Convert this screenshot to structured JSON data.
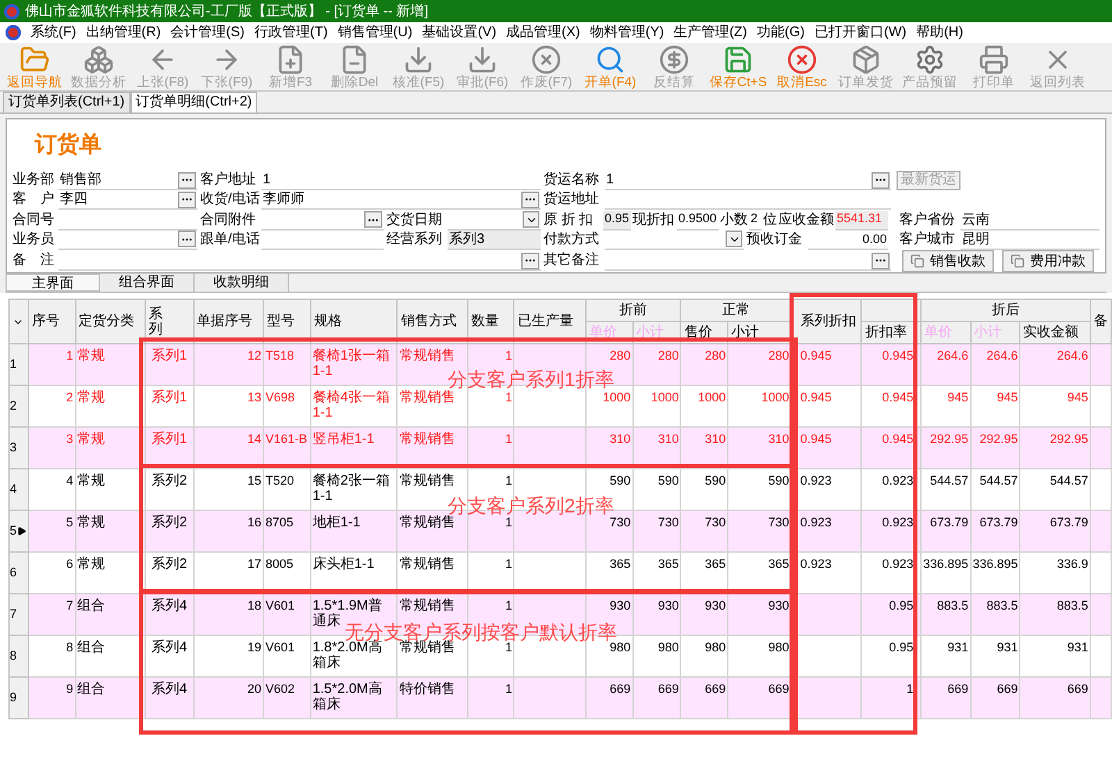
{
  "window": {
    "title": "佛山市金狐软件科技有限公司-工厂版【正式版】 - [订货单 -- 新增]"
  },
  "menu": [
    "系统(F)",
    "出纳管理(R)",
    "会计管理(S)",
    "行政管理(T)",
    "销售管理(U)",
    "基础设置(V)",
    "成品管理(X)",
    "物料管理(Y)",
    "生产管理(Z)",
    "功能(G)",
    "已打开窗口(W)",
    "帮助(H)"
  ],
  "toolbar": [
    {
      "label": "返回导航",
      "disabled": false
    },
    {
      "label": "数据分析",
      "disabled": true
    },
    {
      "label": "上张(F8)",
      "disabled": true
    },
    {
      "label": "下张(F9)",
      "disabled": true
    },
    {
      "label": "新增F3",
      "disabled": true
    },
    {
      "label": "删除Del",
      "disabled": true
    },
    {
      "label": "核准(F5)",
      "disabled": true
    },
    {
      "label": "审批(F6)",
      "disabled": true
    },
    {
      "label": "作废(F7)",
      "disabled": true
    },
    {
      "label": "开单(F4)",
      "disabled": false
    },
    {
      "label": "反结算",
      "disabled": true
    },
    {
      "label": "保存Ct+S",
      "disabled": false
    },
    {
      "label": "取消Esc",
      "disabled": false
    },
    {
      "label": "订单发货",
      "disabled": true
    },
    {
      "label": "产品预留",
      "disabled": true
    },
    {
      "label": "打印单",
      "disabled": true
    },
    {
      "label": "返回列表",
      "disabled": true
    }
  ],
  "tabs": [
    {
      "label": "订货单列表(Ctrl+1)",
      "selected": false
    },
    {
      "label": "订货单明细(Ctrl+2)",
      "selected": true
    }
  ],
  "form": {
    "title": "订货单",
    "department": {
      "label": "业务部",
      "value": "销售部"
    },
    "address": {
      "label": "客户地址",
      "value": "1"
    },
    "carrier_name": {
      "label": "货运名称",
      "value": "1"
    },
    "latest_carrier": {
      "label": "最新货运",
      "disabled": true
    },
    "customer": {
      "label": "客　户",
      "value": "李四"
    },
    "receiver": {
      "label": "收货/电话",
      "value": "李师师"
    },
    "carrier_address": {
      "label": "货运地址"
    },
    "contract_no": {
      "label": "合同号"
    },
    "contract_attachment": {
      "label": "合同附件"
    },
    "delivery_date": {
      "label": "交货日期"
    },
    "original_discount": {
      "label": "原 折 扣",
      "value": "0.95"
    },
    "current_discount": {
      "label": "现折扣",
      "value": "0.9500"
    },
    "decimals": {
      "label": "小数",
      "value": "2",
      "unit": "位"
    },
    "receivable": {
      "label": "应收金额",
      "value": "5541.31"
    },
    "province": {
      "label": "客户省份",
      "value": "云南"
    },
    "salesperson": {
      "label": "业务员"
    },
    "follow_phone": {
      "label": "跟单/电话"
    },
    "business_series": {
      "label": "经营系列",
      "value": "系列3"
    },
    "payment_method": {
      "label": "付款方式"
    },
    "deposit": {
      "label": "预收订金",
      "value": "0.00"
    },
    "city": {
      "label": "客户城市",
      "value": "昆明"
    },
    "remark": {
      "label": "备　注"
    },
    "other_remark": {
      "label": "其它备注"
    },
    "buttons": [
      {
        "label": "销售收款"
      },
      {
        "label": "费用冲款"
      }
    ]
  },
  "subtabs": [
    {
      "label": "主界面",
      "selected": true
    },
    {
      "label": "组合界面",
      "selected": false
    },
    {
      "label": "收款明细",
      "selected": false
    }
  ],
  "table": {
    "groups": [
      "折前",
      "正常",
      "折后"
    ],
    "columns": [
      {
        "label": "序号",
        "disabled": false
      },
      {
        "label": "定货分类",
        "disabled": false
      },
      {
        "label": "系列",
        "disabled": false
      },
      {
        "label": "单据序号",
        "disabled": false
      },
      {
        "label": "型号",
        "disabled": false
      },
      {
        "label": "规格",
        "disabled": false
      },
      {
        "label": "销售方式",
        "disabled": false
      },
      {
        "label": "数量",
        "disabled": false
      },
      {
        "label": "已生产量",
        "disabled": false
      },
      {
        "label": "单价",
        "disabled": true
      },
      {
        "label": "小计",
        "disabled": true
      },
      {
        "label": "售价",
        "disabled": false
      },
      {
        "label": "小计",
        "disabled": false
      },
      {
        "label": "系列折扣",
        "disabled": false
      },
      {
        "label": "折扣率",
        "disabled": false
      },
      {
        "label": "单价",
        "disabled": true
      },
      {
        "label": "小计",
        "disabled": true
      },
      {
        "label": "实收金额",
        "disabled": false
      },
      {
        "label": "备",
        "disabled": false
      }
    ],
    "rows": [
      {
        "row_number": "1",
        "selected": false,
        "highlighted": true,
        "no": "1",
        "category": "常规",
        "series": "系列1",
        "doc_no": "12",
        "model": "T518",
        "spec": "餐椅1张一箱1-1",
        "method": "常规销售",
        "qty": "1",
        "pre_price": "280",
        "pre_subtotal": "280",
        "price": "280",
        "subtotal": "280",
        "series_discount": "0.945",
        "rate": "0.945",
        "post_price": "264.6",
        "post_subtotal": "264.6",
        "received": "264.6"
      },
      {
        "row_number": "2",
        "selected": false,
        "highlighted": true,
        "no": "2",
        "category": "常规",
        "series": "系列1",
        "doc_no": "13",
        "model": "V698",
        "spec": "餐椅4张一箱1-1",
        "method": "常规销售",
        "qty": "1",
        "pre_price": "1000",
        "pre_subtotal": "1000",
        "price": "1000",
        "subtotal": "1000",
        "series_discount": "0.945",
        "rate": "0.945",
        "post_price": "945",
        "post_subtotal": "945",
        "received": "945"
      },
      {
        "row_number": "3",
        "selected": false,
        "highlighted": true,
        "no": "3",
        "category": "常规",
        "series": "系列1",
        "doc_no": "14",
        "model": "V161-B",
        "spec": "竖吊柜1-1",
        "method": "常规销售",
        "qty": "1",
        "pre_price": "310",
        "pre_subtotal": "310",
        "price": "310",
        "subtotal": "310",
        "series_discount": "0.945",
        "rate": "0.945",
        "post_price": "292.95",
        "post_subtotal": "292.95",
        "received": "292.95"
      },
      {
        "row_number": "4",
        "selected": false,
        "highlighted": false,
        "no": "4",
        "category": "常规",
        "series": "系列2",
        "doc_no": "15",
        "model": "T520",
        "spec": "餐椅2张一箱1-1",
        "method": "常规销售",
        "qty": "1",
        "pre_price": "590",
        "pre_subtotal": "590",
        "price": "590",
        "subtotal": "590",
        "series_discount": "0.923",
        "rate": "0.923",
        "post_price": "544.57",
        "post_subtotal": "544.57",
        "received": "544.57"
      },
      {
        "row_number": "5",
        "selected": true,
        "highlighted": false,
        "no": "5",
        "category": "常规",
        "series": "系列2",
        "doc_no": "16",
        "model": "8705",
        "spec": "地柜1-1",
        "method": "常规销售",
        "qty": "1",
        "pre_price": "730",
        "pre_subtotal": "730",
        "price": "730",
        "subtotal": "730",
        "series_discount": "0.923",
        "rate": "0.923",
        "post_price": "673.79",
        "post_subtotal": "673.79",
        "received": "673.79"
      },
      {
        "row_number": "6",
        "selected": false,
        "highlighted": false,
        "no": "6",
        "category": "常规",
        "series": "系列2",
        "doc_no": "17",
        "model": "8005",
        "spec": "床头柜1-1",
        "method": "常规销售",
        "qty": "1",
        "pre_price": "365",
        "pre_subtotal": "365",
        "price": "365",
        "subtotal": "365",
        "series_discount": "0.923",
        "rate": "0.923",
        "post_price": "336.895",
        "post_subtotal": "336.895",
        "received": "336.9"
      },
      {
        "row_number": "7",
        "selected": false,
        "highlighted": false,
        "no": "7",
        "category": "组合",
        "series": "系列4",
        "doc_no": "18",
        "model": "V601",
        "spec": "1.5*1.9M普通床",
        "method": "常规销售",
        "qty": "1",
        "pre_price": "930",
        "pre_subtotal": "930",
        "price": "930",
        "subtotal": "930",
        "rate": "0.95",
        "post_price": "883.5",
        "post_subtotal": "883.5",
        "received": "883.5"
      },
      {
        "row_number": "8",
        "selected": false,
        "highlighted": false,
        "no": "8",
        "category": "组合",
        "series": "系列4",
        "doc_no": "19",
        "model": "V601",
        "spec": "1.8*2.0M高箱床",
        "method": "常规销售",
        "qty": "1",
        "pre_price": "980",
        "pre_subtotal": "980",
        "price": "980",
        "subtotal": "980",
        "rate": "0.95",
        "post_price": "931",
        "post_subtotal": "931",
        "received": "931"
      },
      {
        "row_number": "9",
        "selected": false,
        "highlighted": false,
        "no": "9",
        "category": "组合",
        "series": "系列4",
        "doc_no": "20",
        "model": "V602",
        "spec": "1.5*2.0M高箱床",
        "method": "特价销售",
        "qty": "1",
        "pre_price": "669",
        "pre_subtotal": "669",
        "price": "669",
        "subtotal": "669",
        "rate": "1",
        "post_price": "669",
        "post_subtotal": "669",
        "received": "669"
      }
    ]
  },
  "annotations": [
    {
      "text": "分支客户系列1折率"
    },
    {
      "text": "分支客户系列2折率"
    },
    {
      "text": "无分支客户系列按客户默认折率"
    }
  ]
}
